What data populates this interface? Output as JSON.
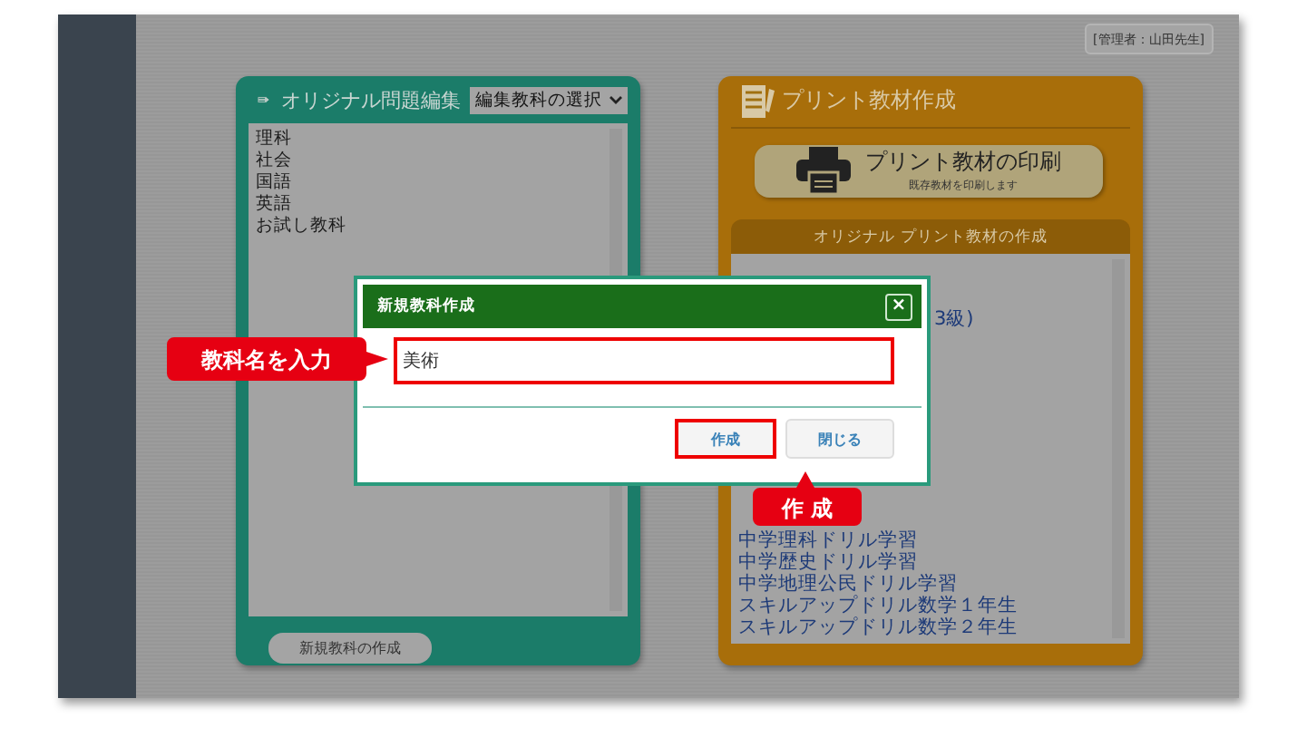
{
  "header": {
    "user_badge": "[管理者：山田先生]"
  },
  "editor_panel": {
    "title": "オリジナル問題編集",
    "subject_select": {
      "value": "編集教科の選択"
    },
    "subjects": [
      "理科",
      "社会",
      "国語",
      "英語",
      "お試し教科"
    ],
    "new_subject_button": "新規教科の作成"
  },
  "print_panel": {
    "title": "プリント教材作成",
    "print_button": {
      "label": "プリント教材の印刷",
      "sublabel": "既存教材を印刷します"
    },
    "section_title": "オリジナル プリント教材の作成",
    "materials": [
      {
        "label": "3級)",
        "kind": "fragment"
      },
      {
        "label": "中学理科ドリル学習",
        "kind": "item"
      },
      {
        "label": "中学歴史ドリル学習",
        "kind": "item"
      },
      {
        "label": "中学地理公民ドリル学習",
        "kind": "item"
      },
      {
        "label": "スキルアップドリル数学１年生",
        "kind": "item"
      },
      {
        "label": "スキルアップドリル数学２年生",
        "kind": "item"
      }
    ]
  },
  "dialog": {
    "title": "新規教科作成",
    "close": "×",
    "name_field": {
      "value": "美術"
    },
    "buttons": [
      {
        "label": "作成",
        "highlighted": true
      },
      {
        "label": "閉じる",
        "highlighted": false
      }
    ]
  },
  "callouts": [
    {
      "text": "教科名を入力",
      "kind": "right"
    },
    {
      "text": "作 成",
      "kind": "up"
    }
  ]
}
